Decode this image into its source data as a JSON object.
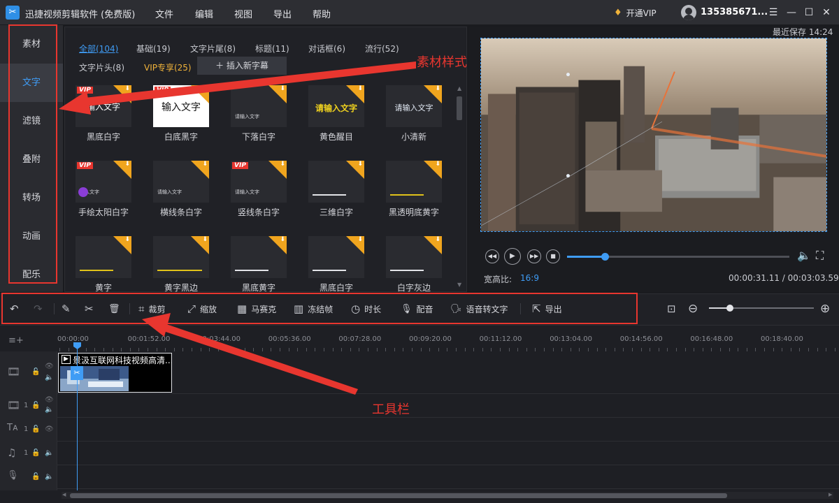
{
  "app": {
    "logo_text": "✂",
    "title": "迅捷视频剪辑软件 (免费版)",
    "menu": [
      "文件",
      "编辑",
      "视图",
      "导出",
      "帮助"
    ],
    "vip_label": "开通VIP",
    "username": "135385671...",
    "window_controls": [
      "☰",
      "—",
      "☐",
      "✕"
    ]
  },
  "sidebar": {
    "items": [
      {
        "label": "素材"
      },
      {
        "label": "文字",
        "active": true
      },
      {
        "label": "滤镜"
      },
      {
        "label": "叠附"
      },
      {
        "label": "转场"
      },
      {
        "label": "动画"
      },
      {
        "label": "配乐"
      }
    ]
  },
  "panel": {
    "filter_tabs": [
      {
        "label": "全部(104)",
        "active": true
      },
      {
        "label": "基础(19)"
      },
      {
        "label": "文字片尾(8)"
      },
      {
        "label": "标题(11)"
      },
      {
        "label": "对话框(6)"
      },
      {
        "label": "流行(52)"
      },
      {
        "label": "文字片头(8)"
      },
      {
        "label": "VIP专享(25)",
        "vip": true
      }
    ],
    "insert_button": "插入新字幕",
    "insert_icon": "＋",
    "tiles": [
      {
        "label": "黑底白字",
        "vip": true,
        "preview": "输入文字"
      },
      {
        "label": "白底黑字",
        "vip": true,
        "preview": "输入文字"
      },
      {
        "label": "下落白字",
        "vip": false,
        "preview": "请输入文字"
      },
      {
        "label": "黄色醒目",
        "vip": false,
        "preview": "请输入文字"
      },
      {
        "label": "小清新",
        "vip": false,
        "preview": "请输入文字"
      },
      {
        "label": "手绘太阳白字",
        "vip": true,
        "preview": "输入文字"
      },
      {
        "label": "横线条白字",
        "vip": false,
        "preview": "请输入文字"
      },
      {
        "label": "竖线条白字",
        "vip": true,
        "preview": "请输入文字"
      },
      {
        "label": "三维白字",
        "vip": false,
        "preview": ""
      },
      {
        "label": "黑透明底黄字",
        "vip": false,
        "preview": ""
      },
      {
        "label": "黄字",
        "vip": false,
        "preview": ""
      },
      {
        "label": "黄字黑边",
        "vip": false,
        "preview": ""
      },
      {
        "label": "黑底黄字",
        "vip": false,
        "preview": ""
      },
      {
        "label": "黑底白字",
        "vip": false,
        "preview": ""
      },
      {
        "label": "白字灰边",
        "vip": false,
        "preview": ""
      }
    ],
    "vip_badge": "VIP",
    "download_icon": "⬇"
  },
  "preview": {
    "autosave": "最近保存 14:24",
    "aspect_label": "宽高比:",
    "aspect_value": "16:9",
    "current_time": "00:00:31.11",
    "total_time": "00:03:03.59",
    "time_separator": " / ",
    "progress": 0.17
  },
  "toolbar": {
    "undo_icon": "↶",
    "redo_icon": "↷",
    "edit_icon": "✎",
    "split_icon": "✂",
    "delete_icon": "🗑",
    "tools": [
      {
        "icon": "⌗",
        "label": "裁剪"
      },
      {
        "icon": "⤢",
        "label": "缩放"
      },
      {
        "icon": "▦",
        "label": "马赛克"
      },
      {
        "icon": "▥",
        "label": "冻结帧"
      },
      {
        "icon": "◷",
        "label": "时长"
      },
      {
        "icon": "🎙",
        "label": "配音"
      },
      {
        "icon": "🗣",
        "label": "语音转文字"
      },
      {
        "icon": "⇱",
        "label": "导出"
      }
    ],
    "fit_icon": "⊡",
    "zoom_out_icon": "⊖",
    "zoom_in_icon": "⊕",
    "zoom_level": 0.2
  },
  "timeline": {
    "add_track_icon": "≡+",
    "ruler_labels": [
      "00:00:00",
      "00:01:52.00",
      "00:03:44.00",
      "00:05:36.00",
      "00:07:28.00",
      "00:09:20.00",
      "00:11:12.00",
      "00:13:04.00",
      "00:14:56.00",
      "00:16:48.00",
      "00:18:40.00"
    ],
    "tracks": [
      {
        "type": "video-main",
        "icon": "🎞",
        "num": ""
      },
      {
        "type": "video",
        "icon": "🎞",
        "num": "1"
      },
      {
        "type": "text",
        "icon": "Tᴀ",
        "num": "1"
      },
      {
        "type": "music",
        "icon": "♫",
        "num": "1"
      },
      {
        "type": "voice",
        "icon": "🎙",
        "num": ""
      }
    ],
    "clip_title": "景汲互联网科技视频高清...",
    "clip_icon": "▶"
  },
  "annotations": {
    "material_style": "素材样式",
    "toolbar_note": "工具栏"
  },
  "colors": {
    "accent": "#3f9cf5",
    "vip": "#f0b33a",
    "annotation_red": "#e8362f"
  }
}
